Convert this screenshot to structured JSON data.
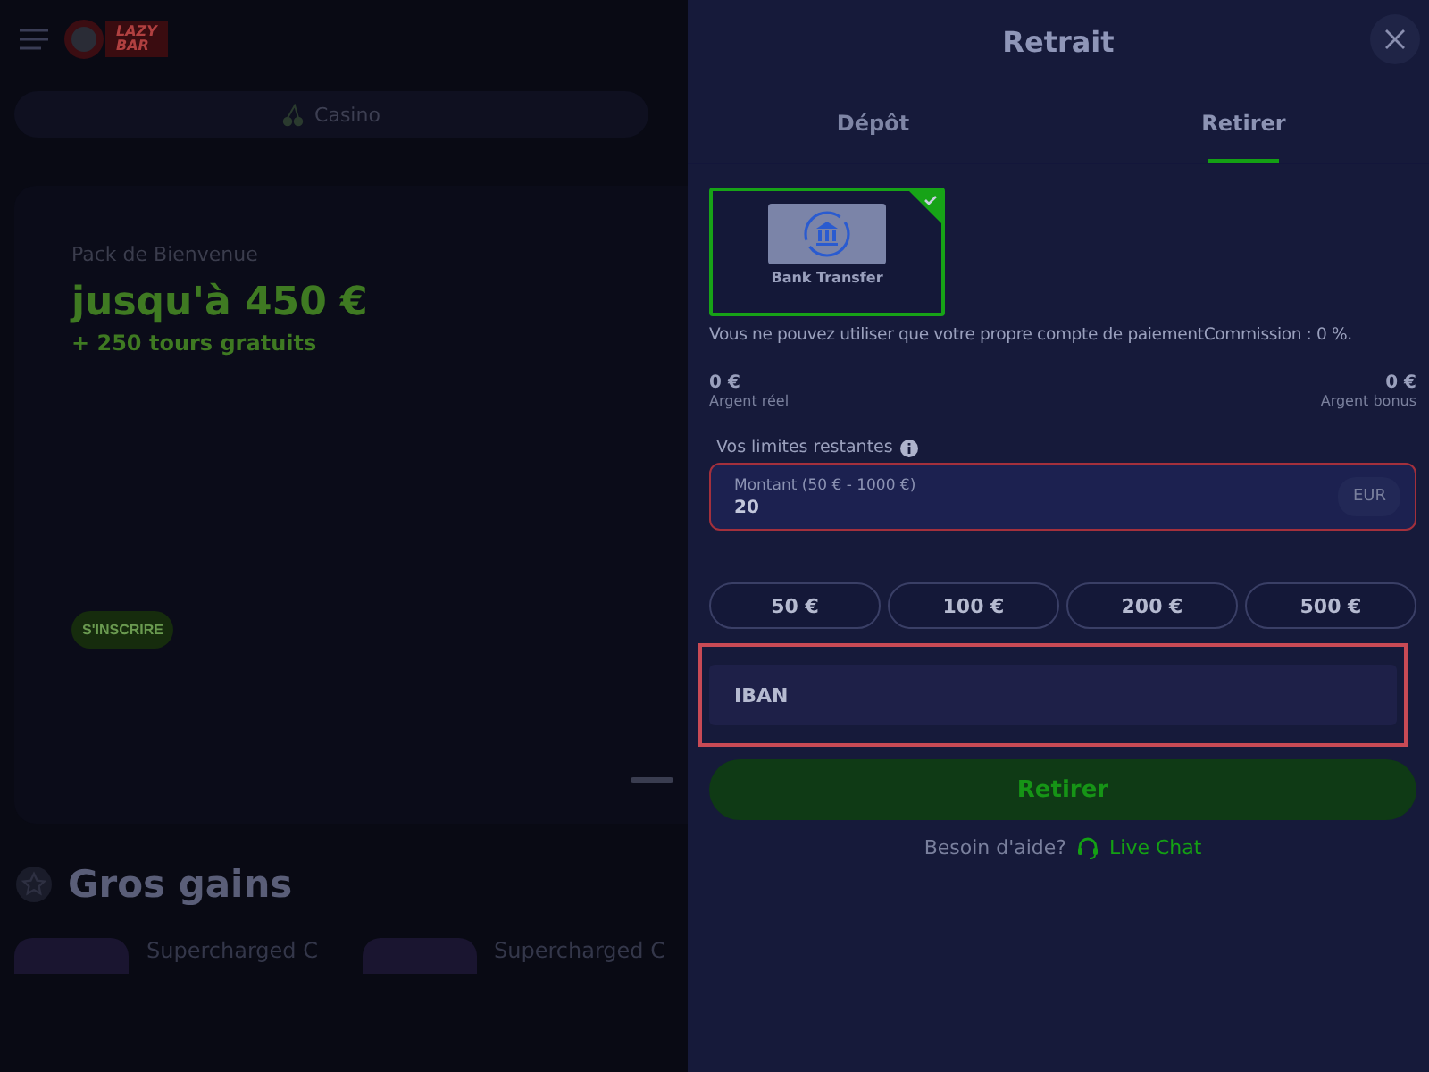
{
  "background_page": {
    "logo": {
      "line_1": "LAZY",
      "line_2": "BAR"
    },
    "nav_tab": {
      "label": "Casino"
    },
    "banner": {
      "subtitle": "Pack de Bienvenue",
      "headline": "jusqu'à 450 €",
      "bonus": "+ 250 tours gratuits",
      "button": "S'INSCRIRE"
    },
    "section": {
      "title": "Gros gains"
    },
    "games": [
      {
        "title": "Supercharged C"
      },
      {
        "title": "Supercharged C"
      }
    ]
  },
  "modal": {
    "title": "Retrait",
    "tabs": [
      {
        "label": "Dépôt",
        "selected": false
      },
      {
        "label": "Retirer",
        "selected": true
      }
    ],
    "methods": [
      {
        "label": "Bank Transfer",
        "selected": true
      }
    ],
    "notice": "Vous ne pouvez utiliser que votre propre compte de paiementCommission : 0 %.",
    "balances": [
      {
        "amount": "0 €",
        "label": "Argent réel"
      },
      {
        "amount": "0 €",
        "label": "Argent bonus"
      }
    ],
    "limits_label": "Vos limites restantes",
    "amount_field": {
      "label": "Montant (50 € - 1000 €)",
      "value": "20",
      "currency": "EUR",
      "invalid": true
    },
    "presets": [
      "50 €",
      "100 €",
      "200 €",
      "500 €"
    ],
    "iban_field": {
      "placeholder": "IBAN",
      "invalid": true
    },
    "submit": "Retirer",
    "help": {
      "text": "Besoin d'aide?",
      "link": "Live Chat"
    }
  }
}
